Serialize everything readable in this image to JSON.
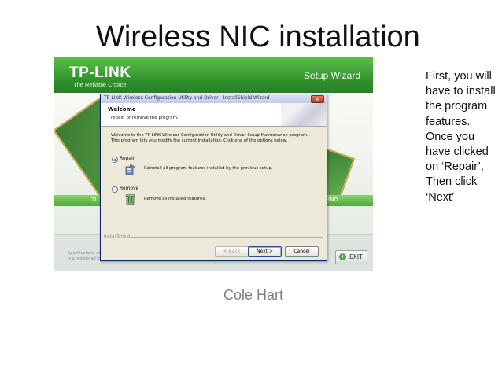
{
  "slide": {
    "title": "Wireless NIC installation",
    "note": "First, you will have to install the program features. Once you have clicked on ‘Repair’, Then click ‘Next’",
    "author": "Cole Hart"
  },
  "installer": {
    "brand": "TP-LINK",
    "tagline": "The Reliable Choice",
    "header_title": "Setup Wizard",
    "band_left": "TL",
    "band_right": "IND",
    "footer_text": "Specifications are\nis a registered tra",
    "exit_label": "EXIT",
    "colors": {
      "brand_green": "#2d8f2a",
      "band_green": "#4ea83d"
    }
  },
  "dialog": {
    "title": "TP-LINK Wireless Configuration Utility and Driver - InstallShield Wizard",
    "close_glyph": "x",
    "heading": "Welcome",
    "subheading": "repair, or remove the program.",
    "description": "Welcome to the TP-LINK Wireless Configuration Utility and Driver Setup Maintenance program. This program lets you modify the current installation. Click one of the options below.",
    "options": [
      {
        "label": "Repair",
        "description": "Reinstall all program features installed by the previous setup.",
        "selected": true,
        "icon": "repair-icon"
      },
      {
        "label": "Remove",
        "description": "Remove all installed features.",
        "selected": false,
        "icon": "remove-icon"
      }
    ],
    "group_label": "InstallShield",
    "buttons": {
      "back": "< Back",
      "next": "Next >",
      "cancel": "Cancel"
    }
  }
}
